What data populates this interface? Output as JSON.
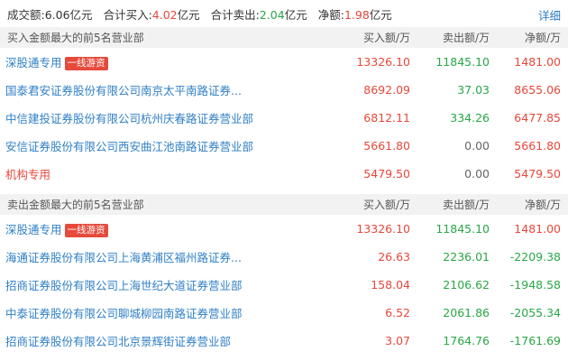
{
  "summary": {
    "turnover_label": "成交额:",
    "turnover_value": "6.06亿元",
    "buy_label": "合计买入:",
    "buy_value": "4.02",
    "buy_unit": "亿元",
    "sell_label": "合计卖出:",
    "sell_value": "2.04",
    "sell_unit": "亿元",
    "net_label": "净额:",
    "net_value": "1.98",
    "net_unit": "亿元",
    "detail_link": "详细"
  },
  "columns": {
    "buy": "买入额/万",
    "sell": "卖出额/万",
    "net": "净额/万"
  },
  "buy_section": {
    "title": "买入金额最大的前5名营业部",
    "rows": [
      {
        "name": "深股通专用",
        "tag": "一线游资",
        "buy": "13326.10",
        "sell": "11845.10",
        "net": "1481.00",
        "net_sign": "red",
        "sell_color": "green"
      },
      {
        "name": "国泰君安证券股份有限公司南京太平南路证券...",
        "tag": "",
        "buy": "8692.09",
        "sell": "37.03",
        "net": "8655.06",
        "net_sign": "red",
        "sell_color": "green"
      },
      {
        "name": "中信建投证券股份有限公司杭州庆春路证券营业部",
        "tag": "",
        "buy": "6812.11",
        "sell": "334.26",
        "net": "6477.85",
        "net_sign": "red",
        "sell_color": "green"
      },
      {
        "name": "安信证券股份有限公司西安曲江池南路证券营业部",
        "tag": "",
        "buy": "5661.80",
        "sell": "0.00",
        "net": "5661.80",
        "net_sign": "red",
        "sell_color": "neutral"
      },
      {
        "name": "机构专用",
        "tag": "",
        "buy": "5479.50",
        "sell": "0.00",
        "net": "5479.50",
        "net_sign": "red",
        "sell_color": "neutral",
        "name_color": "red"
      }
    ]
  },
  "sell_section": {
    "title": "卖出金额最大的前5名营业部",
    "rows": [
      {
        "name": "深股通专用",
        "tag": "一线游资",
        "buy": "13326.10",
        "sell": "11845.10",
        "net": "1481.00",
        "net_sign": "red",
        "sell_color": "green"
      },
      {
        "name": "海通证券股份有限公司上海黄浦区福州路证券...",
        "tag": "",
        "buy": "26.63",
        "sell": "2236.01",
        "net": "-2209.38",
        "net_sign": "green",
        "sell_color": "green"
      },
      {
        "name": "招商证券股份有限公司上海世纪大道证券营业部",
        "tag": "",
        "buy": "158.04",
        "sell": "2106.62",
        "net": "-1948.58",
        "net_sign": "green",
        "sell_color": "green"
      },
      {
        "name": "中泰证券股份有限公司聊城柳园南路证券营业部",
        "tag": "",
        "buy": "6.52",
        "sell": "2061.86",
        "net": "-2055.34",
        "net_sign": "green",
        "sell_color": "green"
      },
      {
        "name": "招商证券股份有限公司北京景辉街证券营业部",
        "tag": "",
        "buy": "3.07",
        "sell": "1764.76",
        "net": "-1761.69",
        "net_sign": "green",
        "sell_color": "green"
      }
    ]
  },
  "colors": {
    "red": "#e8473a",
    "green": "#28a745",
    "link": "#2f7fc5",
    "tag_bg": "#e64a3b",
    "header_bg": "#f2f2f2"
  }
}
